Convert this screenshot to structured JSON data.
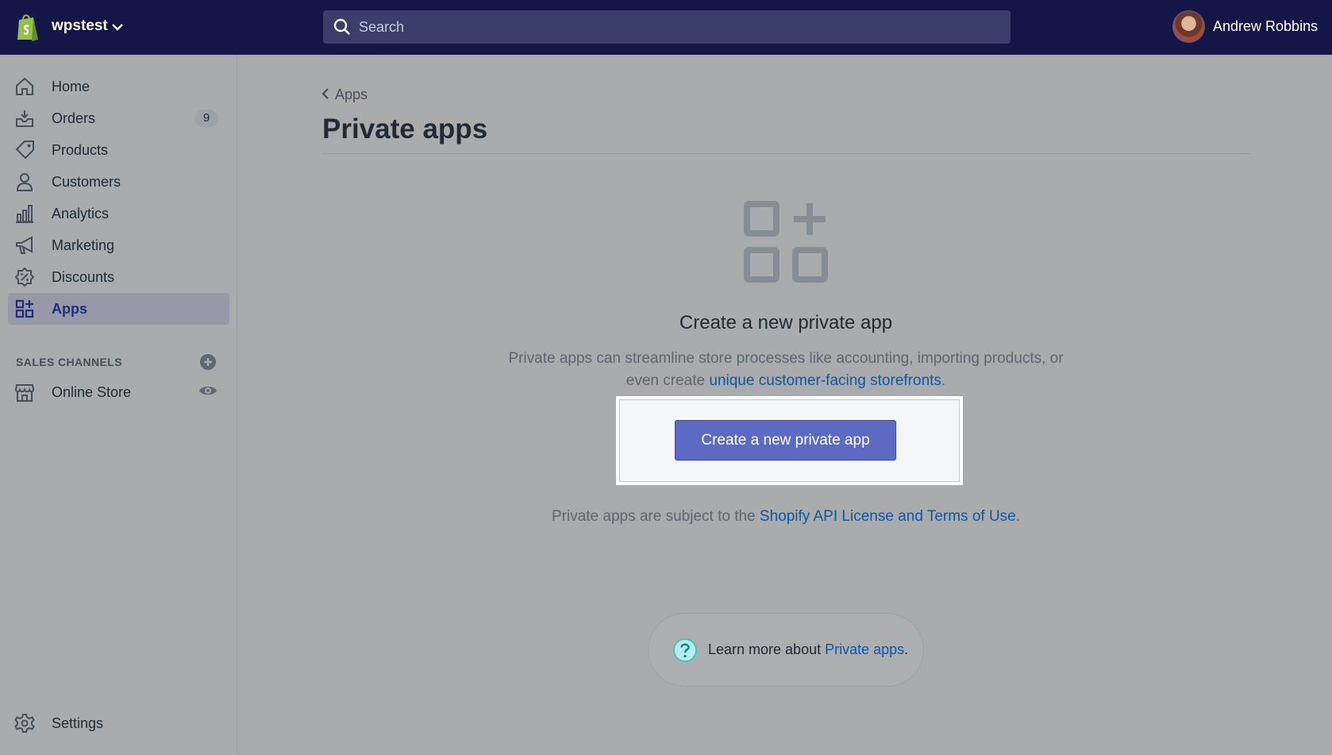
{
  "topbar": {
    "store_name": "wpstest",
    "search_placeholder": "Search",
    "user_name": "Andrew Robbins"
  },
  "sidebar": {
    "items": [
      {
        "label": "Home",
        "icon": "home-icon"
      },
      {
        "label": "Orders",
        "icon": "orders-icon",
        "badge": "9"
      },
      {
        "label": "Products",
        "icon": "tag-icon"
      },
      {
        "label": "Customers",
        "icon": "person-icon"
      },
      {
        "label": "Analytics",
        "icon": "bar-chart-icon"
      },
      {
        "label": "Marketing",
        "icon": "megaphone-icon"
      },
      {
        "label": "Discounts",
        "icon": "discount-icon"
      },
      {
        "label": "Apps",
        "icon": "apps-icon",
        "active": true
      }
    ],
    "sales_channels_heading": "SALES CHANNELS",
    "channels": [
      {
        "label": "Online Store",
        "icon": "store-icon"
      }
    ],
    "settings_label": "Settings"
  },
  "main": {
    "breadcrumb": "Apps",
    "title": "Private apps",
    "empty_state": {
      "heading": "Create a new private app",
      "body_prefix": "Private apps can streamline store processes like accounting, importing products, or even create ",
      "body_link": "unique customer-facing storefronts",
      "body_suffix": ".",
      "button": "Create a new private app"
    },
    "terms_prefix": "Private apps are subject to the ",
    "terms_link": "Shopify API License and Terms of Use",
    "terms_suffix": ".",
    "help_prefix": "Learn more about ",
    "help_link": "Private apps",
    "help_suffix": "."
  },
  "colors": {
    "topbar": "#131646",
    "primary_button": "#5c6ac4",
    "link": "#0b5aa3",
    "active_nav": "#202e78"
  }
}
